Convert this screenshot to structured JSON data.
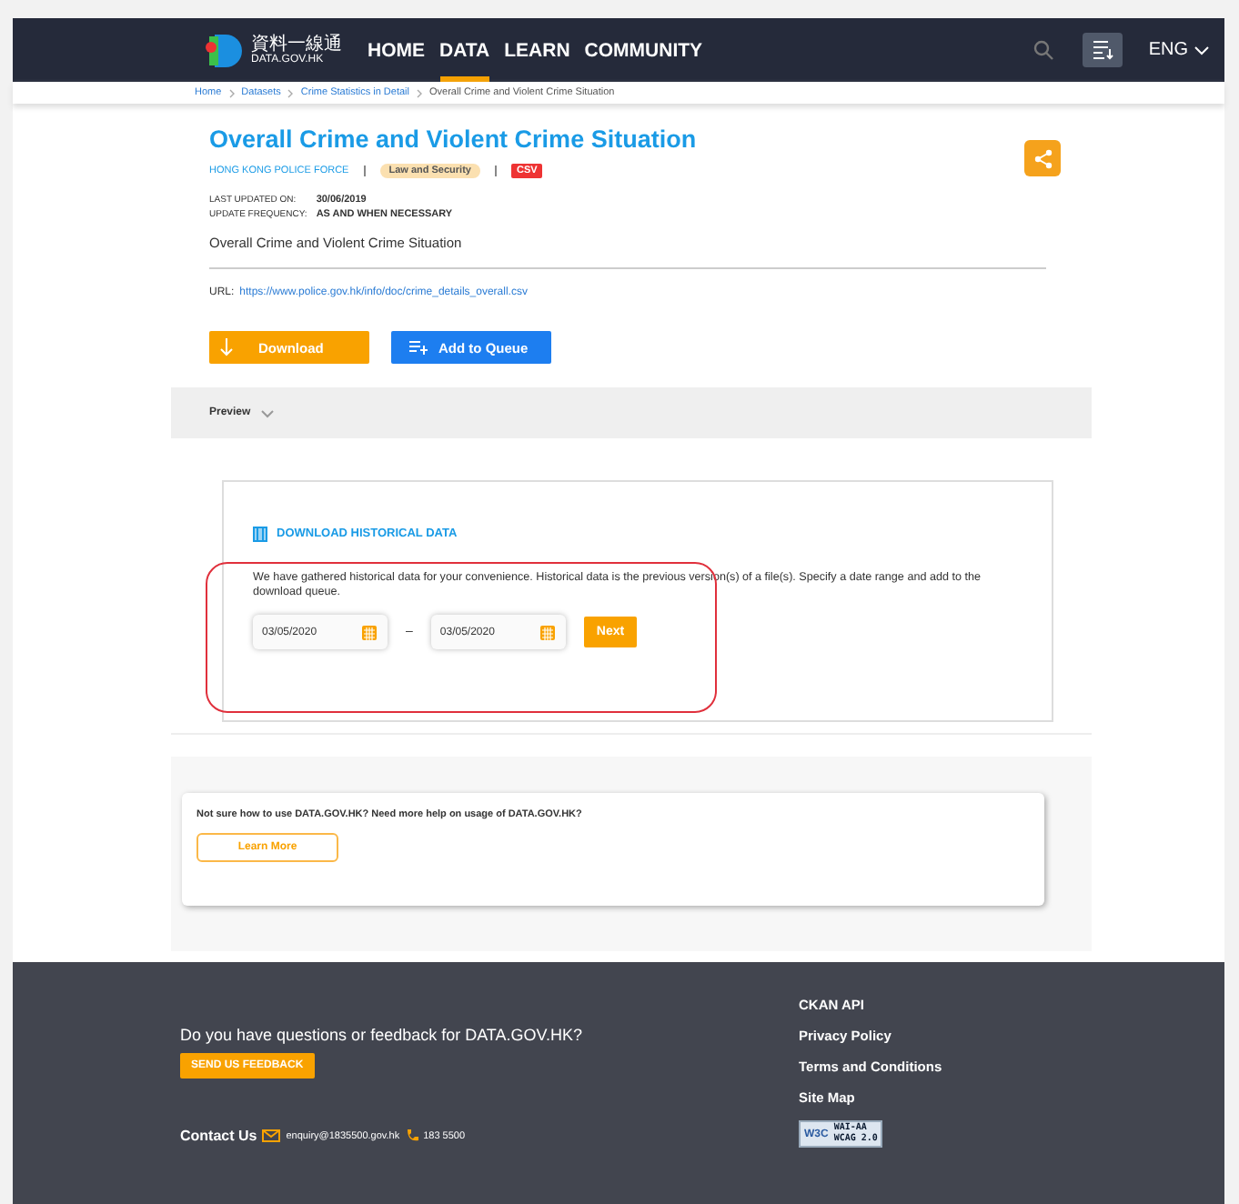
{
  "header": {
    "logo_text": "資料一線通",
    "logo_sub": "DATA.GOV.HK",
    "nav": [
      {
        "label": "HOME",
        "selected": false
      },
      {
        "label": "DATA",
        "selected": true
      },
      {
        "label": "LEARN",
        "selected": false
      },
      {
        "label": "COMMUNITY",
        "selected": false
      }
    ],
    "language": "ENG"
  },
  "breadcrumb": [
    "Home",
    "Datasets",
    "Crime Statistics in Detail",
    "Overall Crime and Violent Crime Situation"
  ],
  "dataset": {
    "title": "Overall Crime and Violent Crime Situation",
    "provider": "HONG KONG POLICE FORCE",
    "category": "Law and Security",
    "format": "CSV",
    "last_updated_label": "LAST UPDATED ON:",
    "last_updated": "30/06/2019",
    "frequency_label": "UPDATE FREQUENCY:",
    "frequency": "AS AND WHEN NECESSARY",
    "description": "Overall Crime and Violent Crime Situation",
    "url_label": "URL:",
    "url": "https://www.police.gov.hk/info/doc/crime_details_overall.csv",
    "buttons": [
      "Download",
      "Add to Queue"
    ]
  },
  "preview": {
    "label": "Preview",
    "expanded": false
  },
  "historical": {
    "title": "DOWNLOAD HISTORICAL DATA",
    "text": "We have gathered historical data for your convenience. Historical data is the previous version(s) of a file(s). Specify a date range and add to the download queue.",
    "from": "03/05/2020",
    "separator": "–",
    "to": "03/05/2020",
    "button": "Next"
  },
  "help": {
    "text": "Not sure how to use DATA.GOV.HK? Need more help on usage of DATA.GOV.HK?",
    "button": "Learn More"
  },
  "footer": {
    "question": "Do you have questions or feedback for DATA.GOV.HK?",
    "feedback_button": "SEND US FEEDBACK",
    "contact_label": "Contact Us",
    "email": "enquiry@1835500.gov.hk",
    "phone": "183 5500",
    "links": [
      "CKAN API",
      "Privacy Policy",
      "Terms and Conditions",
      "Site Map"
    ],
    "badge": [
      "W3C",
      "WAI-AA",
      "WCAG 2.0"
    ]
  }
}
